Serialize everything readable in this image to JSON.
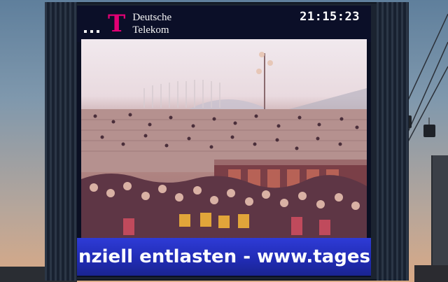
{
  "scene": {
    "sky_top": "#5f7f9c",
    "sky_bottom": "#d9a986"
  },
  "screen": {
    "logo": {
      "mark": "T",
      "line1": "Deutsche",
      "line2": "Telekom",
      "brand_color": "#e20074"
    },
    "clock": "21:15:23",
    "ticker_text": "nziell entlasten - www.tagessc"
  }
}
